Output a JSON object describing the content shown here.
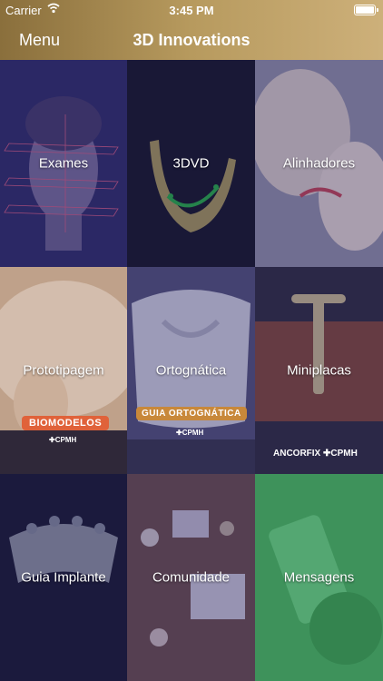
{
  "status": {
    "carrier": "Carrier",
    "time": "3:45 PM"
  },
  "nav": {
    "menu": "Menu",
    "title": "3D Innovations"
  },
  "tiles": [
    {
      "label": "Exames"
    },
    {
      "label": "3DVD"
    },
    {
      "label": "Alinhadores"
    },
    {
      "label": "Prototipagem",
      "badge": "BIOMODELOS",
      "brand": "✚CPMH"
    },
    {
      "label": "Ortognática",
      "badge": "GUIA ORTOGNÁTICA",
      "brand": "✚CPMH"
    },
    {
      "label": "Miniplacas",
      "badge": "ANCORFIX ✚CPMH"
    },
    {
      "label": "Guia Implante"
    },
    {
      "label": "Comunidade"
    },
    {
      "label": "Mensagens"
    }
  ]
}
